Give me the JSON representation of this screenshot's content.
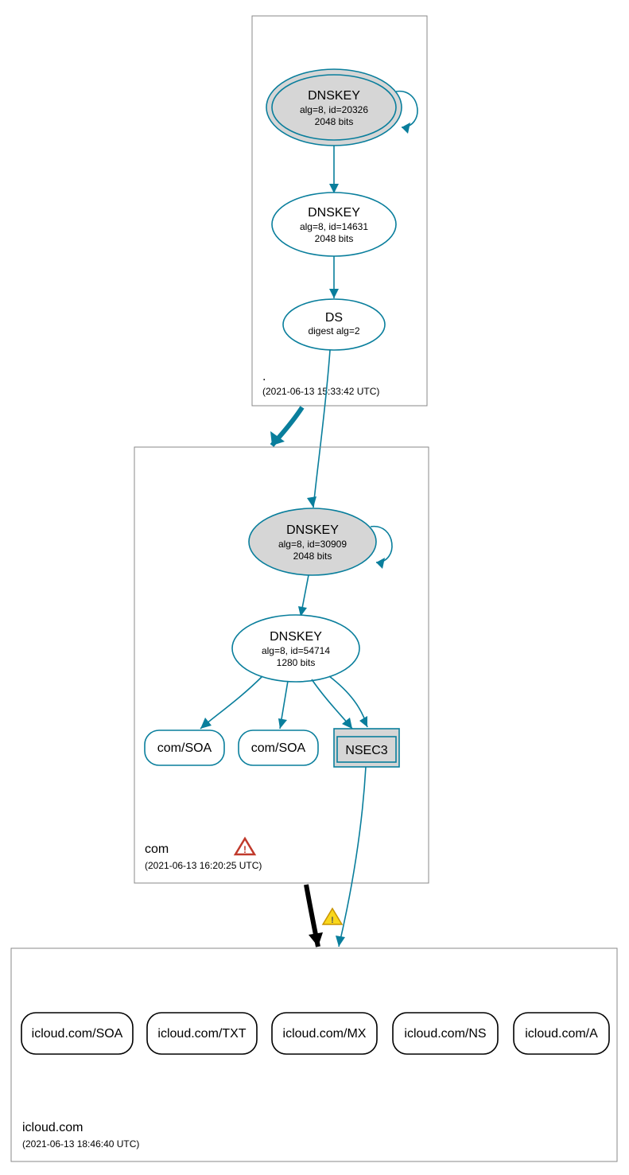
{
  "zones": {
    "root": {
      "name": ".",
      "timestamp": "(2021-06-13 15:33:42 UTC)",
      "ksk": {
        "title": "DNSKEY",
        "line1": "alg=8, id=20326",
        "line2": "2048 bits"
      },
      "zsk": {
        "title": "DNSKEY",
        "line1": "alg=8, id=14631",
        "line2": "2048 bits"
      },
      "ds": {
        "title": "DS",
        "line1": "digest alg=2"
      }
    },
    "com": {
      "name": "com",
      "timestamp": "(2021-06-13 16:20:25 UTC)",
      "ksk": {
        "title": "DNSKEY",
        "line1": "alg=8, id=30909",
        "line2": "2048 bits"
      },
      "zsk": {
        "title": "DNSKEY",
        "line1": "alg=8, id=54714",
        "line2": "1280 bits"
      },
      "rr1": "com/SOA",
      "rr2": "com/SOA",
      "nsec3": "NSEC3"
    },
    "icloud": {
      "name": "icloud.com",
      "timestamp": "(2021-06-13 18:46:40 UTC)",
      "rr": [
        "icloud.com/SOA",
        "icloud.com/TXT",
        "icloud.com/MX",
        "icloud.com/NS",
        "icloud.com/A"
      ]
    }
  }
}
